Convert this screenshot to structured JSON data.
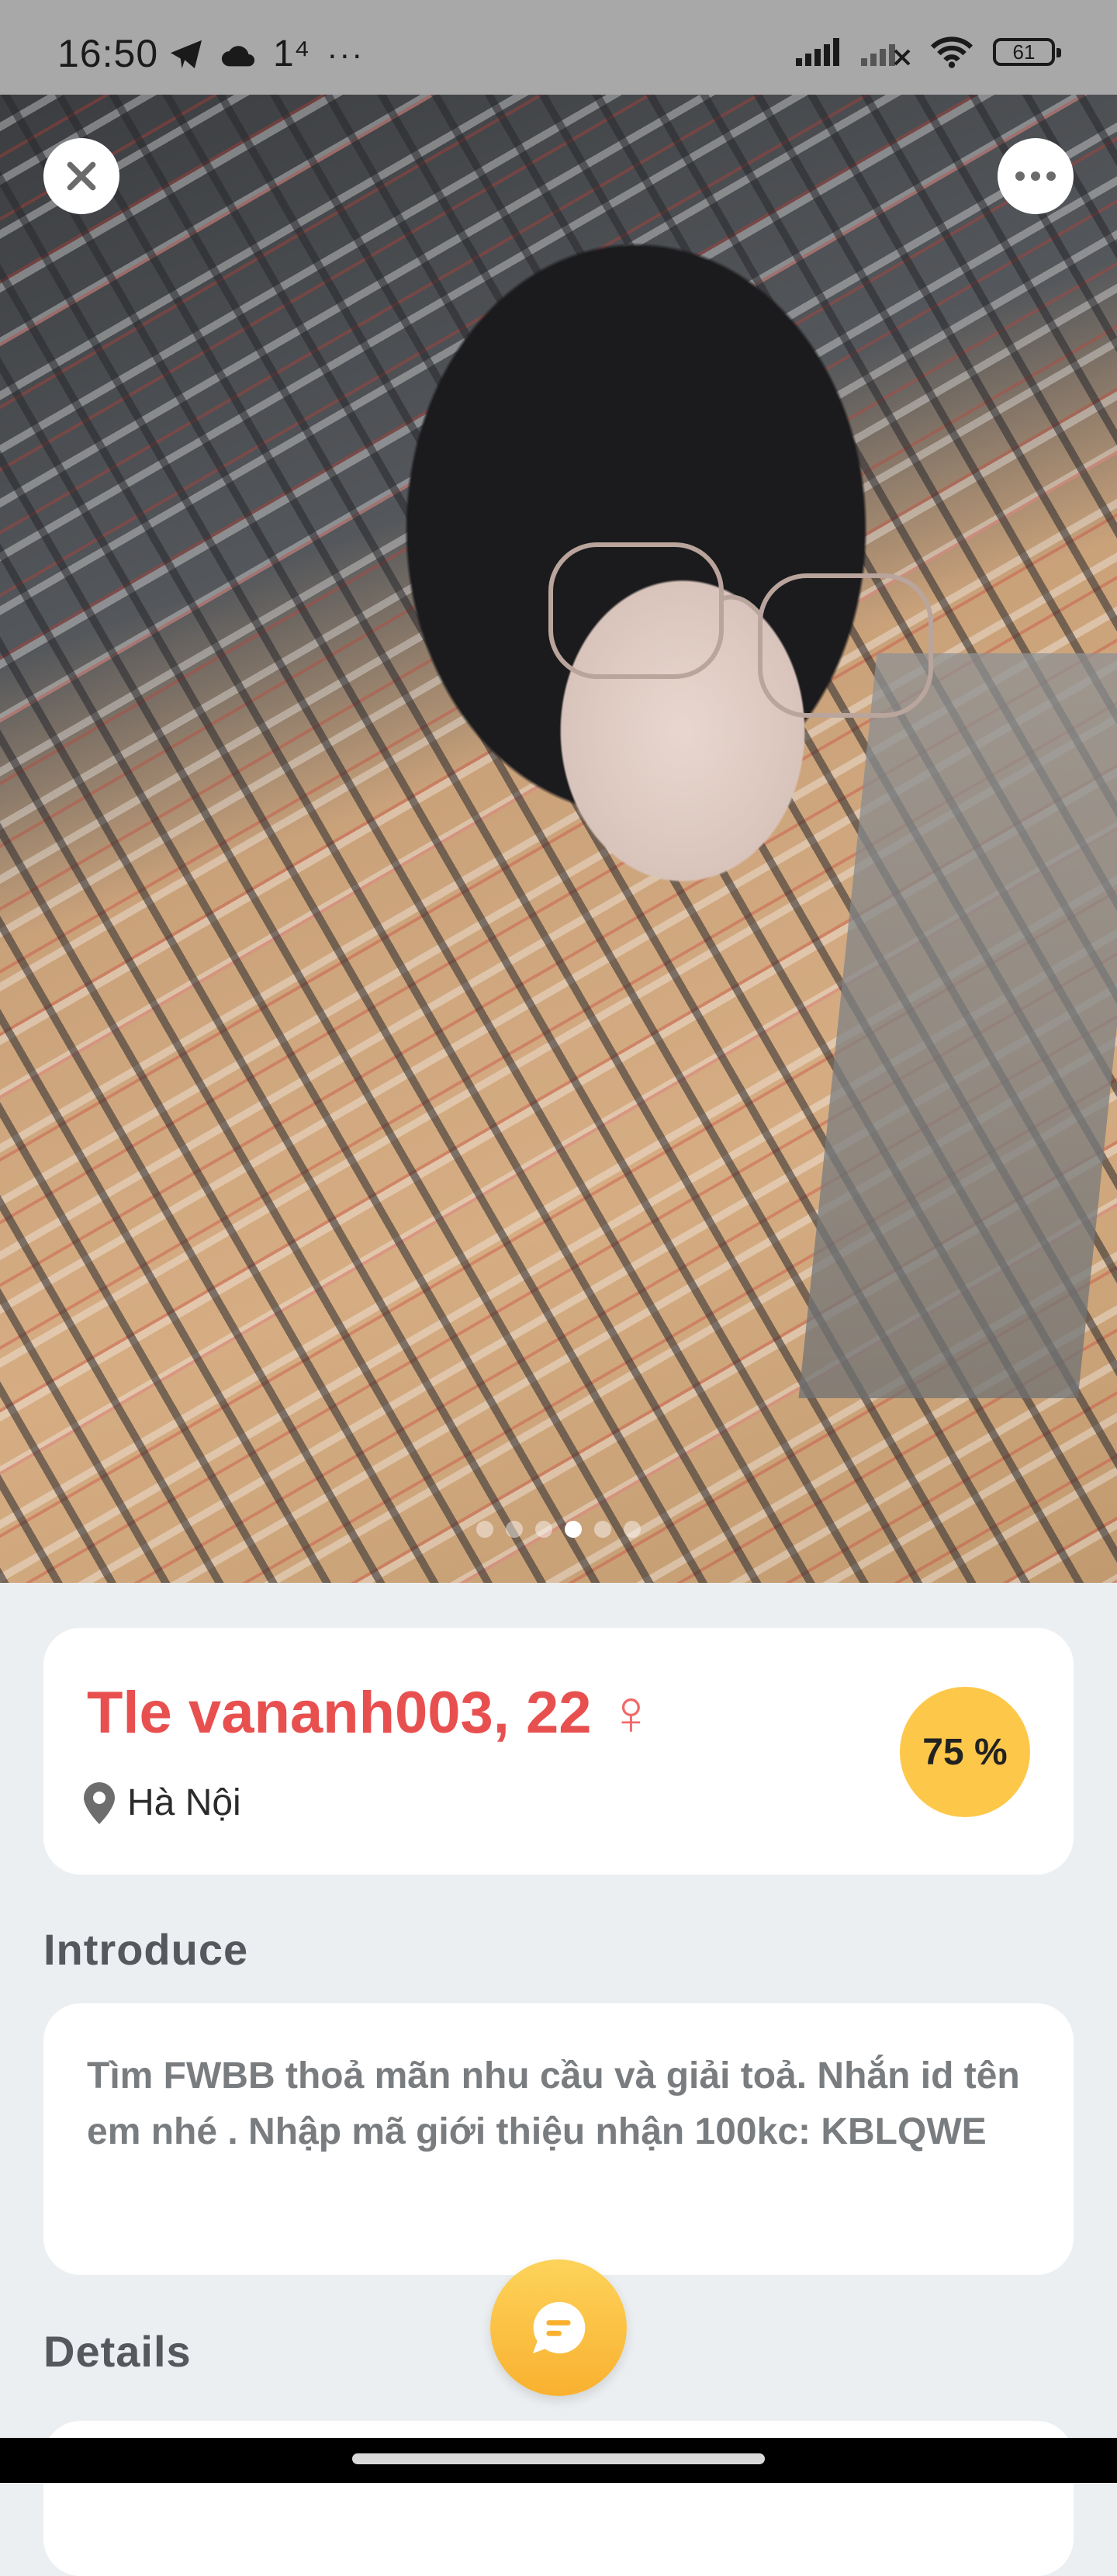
{
  "status_bar": {
    "time": "16:50",
    "left_extra": "1⁴",
    "more": "···",
    "battery": "61",
    "icons": [
      "telegram-icon",
      "cloud-icon",
      "signal-icon",
      "signal-no-service-icon",
      "wifi-icon",
      "battery-icon"
    ]
  },
  "photo": {
    "pager": {
      "count": 6,
      "active_index": 3
    }
  },
  "profile": {
    "name_age": "Tle vananh003, 22",
    "gender_symbol": "♀",
    "location": "Hà Nội",
    "match": "75 %"
  },
  "introduce": {
    "title": "Introduce",
    "text": "Tìm FWBB thoả mãn nhu cầu và giải toả. Nhắn id tên em nhé . Nhập mã giới thiệu nhận 100kc: KBLQWE"
  },
  "details": {
    "title": "Details"
  },
  "colors": {
    "name": "#E8504F",
    "match_badge": "#FDC84A",
    "background": "#ECEFF1",
    "fab": "#F9B130"
  }
}
